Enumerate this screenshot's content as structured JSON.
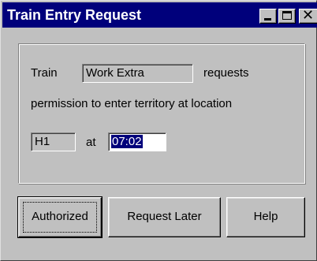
{
  "window": {
    "title": "Train Entry Request"
  },
  "titlebar_buttons": {
    "minimize": "minimize-icon",
    "maximize": "maximize-icon",
    "close": "close-icon"
  },
  "form": {
    "train_label": "Train",
    "train_value": "Work Extra",
    "requests_label": "requests",
    "permission_text": "permission to enter territory at location",
    "location_value": "H1",
    "at_label": "at",
    "time_value": "07:02"
  },
  "buttons": {
    "authorized": "Authorized",
    "request_later": "Request Later",
    "help": "Help"
  },
  "colors": {
    "titlebar": "#00007b",
    "face": "#c0c0c0",
    "selection": "#00007b"
  }
}
